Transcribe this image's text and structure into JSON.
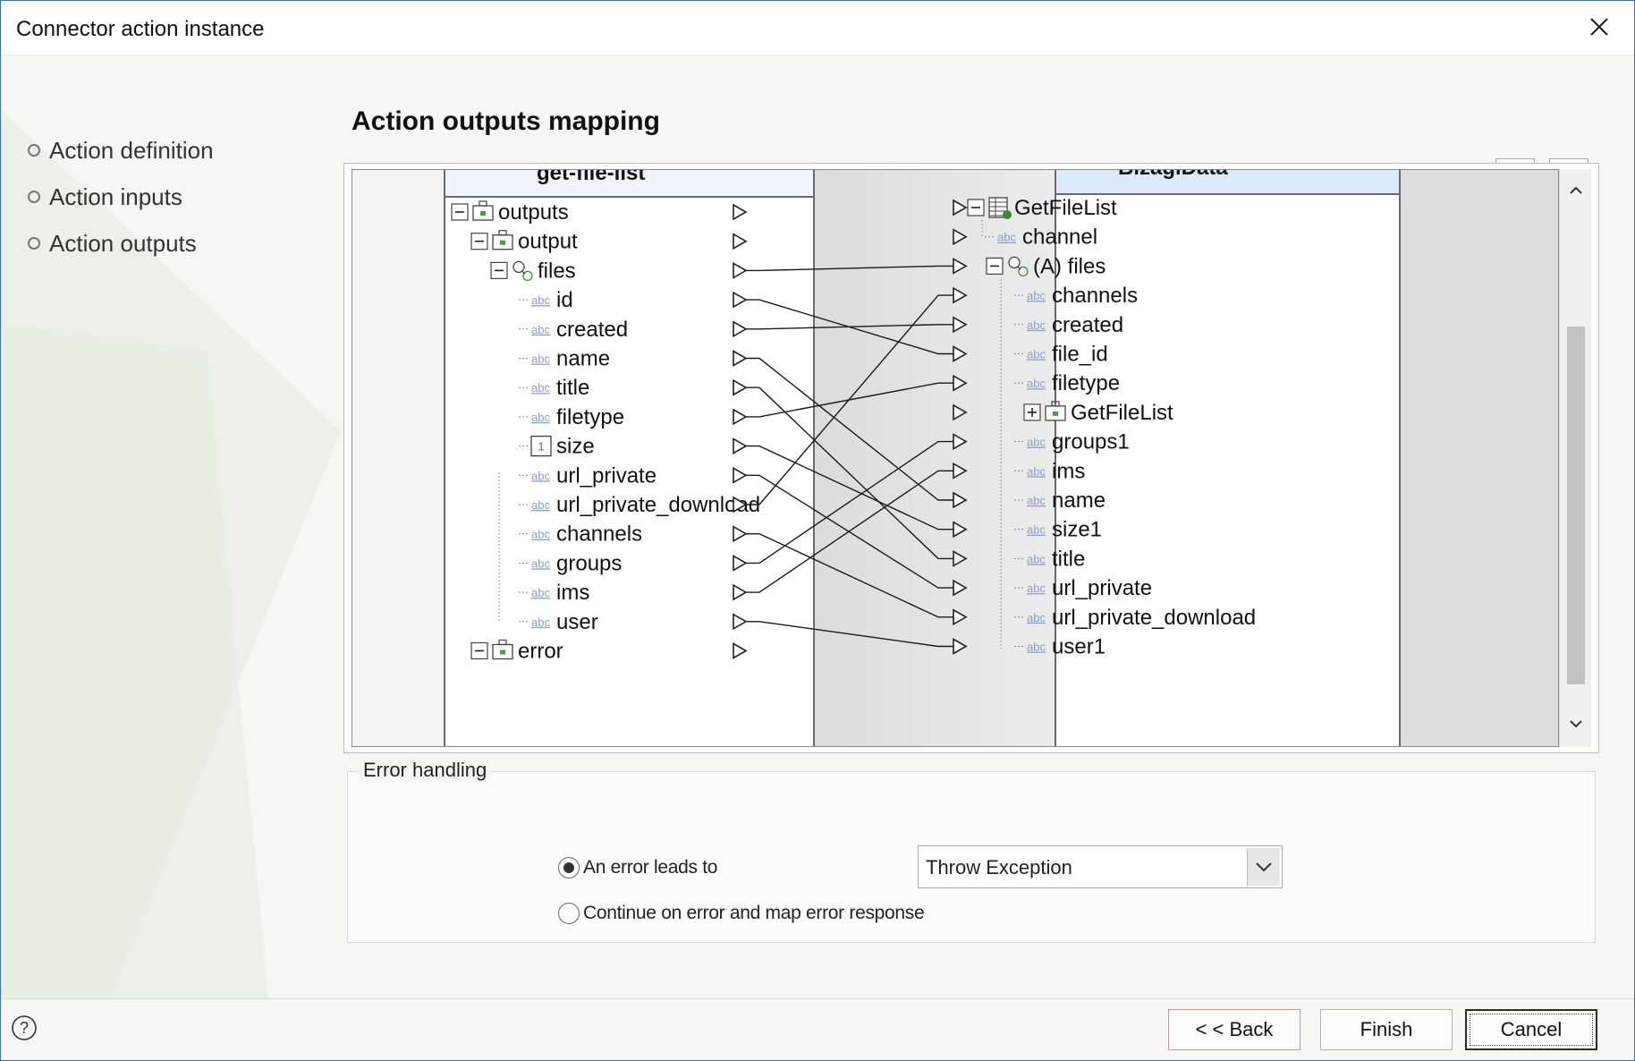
{
  "window": {
    "title": "Connector action instance"
  },
  "nav": {
    "items": [
      {
        "label": "Action definition"
      },
      {
        "label": "Action inputs"
      },
      {
        "label": "Action outputs"
      }
    ]
  },
  "page": {
    "title": "Action outputs mapping"
  },
  "toolbar": {
    "icons": [
      "auto-map-icon",
      "layout-icon"
    ]
  },
  "mapper": {
    "source": {
      "header": "get-file-list",
      "nodes": [
        {
          "label": "outputs",
          "kind": "object"
        },
        {
          "label": "output",
          "kind": "object"
        },
        {
          "label": "files",
          "kind": "collection"
        },
        {
          "label": "id",
          "kind": "string"
        },
        {
          "label": "created",
          "kind": "string"
        },
        {
          "label": "name",
          "kind": "string"
        },
        {
          "label": "title",
          "kind": "string"
        },
        {
          "label": "filetype",
          "kind": "string"
        },
        {
          "label": "size",
          "kind": "number"
        },
        {
          "label": "url_private",
          "kind": "string"
        },
        {
          "label": "url_private_download",
          "kind": "string"
        },
        {
          "label": "channels",
          "kind": "string"
        },
        {
          "label": "groups",
          "kind": "string"
        },
        {
          "label": "ims",
          "kind": "string"
        },
        {
          "label": "user",
          "kind": "string"
        },
        {
          "label": "error",
          "kind": "object"
        }
      ]
    },
    "target": {
      "header": "BizagiData",
      "nodes": [
        {
          "label": "GetFileList",
          "kind": "table"
        },
        {
          "label": "channel",
          "kind": "string"
        },
        {
          "label": "(A) files",
          "kind": "collection"
        },
        {
          "label": "channels",
          "kind": "string"
        },
        {
          "label": "created",
          "kind": "string"
        },
        {
          "label": "file_id",
          "kind": "string"
        },
        {
          "label": "filetype",
          "kind": "string"
        },
        {
          "label": "GetFileList",
          "kind": "object"
        },
        {
          "label": "groups1",
          "kind": "string"
        },
        {
          "label": "ims",
          "kind": "string"
        },
        {
          "label": "name",
          "kind": "string"
        },
        {
          "label": "size1",
          "kind": "string"
        },
        {
          "label": "title",
          "kind": "string"
        },
        {
          "label": "url_private",
          "kind": "string"
        },
        {
          "label": "url_private_download",
          "kind": "string"
        },
        {
          "label": "user1",
          "kind": "string"
        }
      ]
    },
    "type_icon_text": "abc",
    "number_icon_text": "1",
    "connections": [
      {
        "from": "files",
        "to": "(A) files"
      },
      {
        "from": "id",
        "to": "file_id"
      },
      {
        "from": "created",
        "to": "created"
      },
      {
        "from": "name",
        "to": "name"
      },
      {
        "from": "title",
        "to": "title"
      },
      {
        "from": "filetype",
        "to": "filetype"
      },
      {
        "from": "size",
        "to": "size1"
      },
      {
        "from": "url_private",
        "to": "url_private"
      },
      {
        "from": "url_private_download",
        "to": "channels"
      },
      {
        "from": "channels",
        "to": "url_private_download"
      },
      {
        "from": "groups",
        "to": "groups1"
      },
      {
        "from": "ims",
        "to": "ims"
      },
      {
        "from": "user",
        "to": "user1"
      }
    ]
  },
  "error_handling": {
    "legend": "Error handling",
    "option_throw": "An error leads to",
    "option_continue": "Continue on error and map error response",
    "selected_option": "option_throw",
    "select_value": "Throw Exception"
  },
  "footer": {
    "back_label": "< < Back",
    "finish_label": "Finish",
    "cancel_label": "Cancel"
  }
}
